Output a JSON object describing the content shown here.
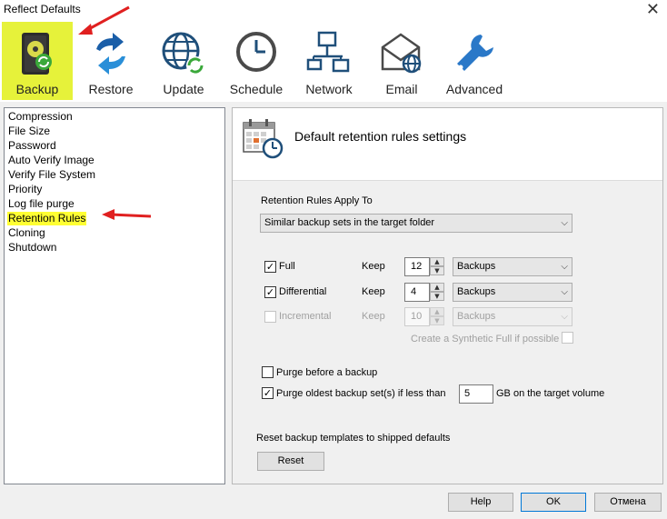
{
  "window": {
    "title": "Reflect Defaults"
  },
  "toolbar": {
    "items": [
      {
        "label": "Backup",
        "icon": "backup-drive-icon",
        "active": true
      },
      {
        "label": "Restore",
        "icon": "restore-arrows-icon"
      },
      {
        "label": "Update",
        "icon": "globe-update-icon"
      },
      {
        "label": "Schedule",
        "icon": "clock-icon"
      },
      {
        "label": "Network",
        "icon": "network-icon"
      },
      {
        "label": "Email",
        "icon": "envelope-icon"
      },
      {
        "label": "Advanced",
        "icon": "wrench-icon"
      }
    ]
  },
  "nav": {
    "items": [
      {
        "label": "Compression"
      },
      {
        "label": "File Size"
      },
      {
        "label": "Password"
      },
      {
        "label": "Auto Verify Image"
      },
      {
        "label": "Verify File System"
      },
      {
        "label": "Priority"
      },
      {
        "label": "Log file purge"
      },
      {
        "label": "Retention Rules",
        "selected": true
      },
      {
        "label": "Cloning"
      },
      {
        "label": "Shutdown"
      }
    ]
  },
  "panel": {
    "title": "Default retention rules settings",
    "apply_to_label": "Retention Rules Apply To",
    "apply_to_value": "Similar backup sets in the target folder",
    "keep_label": "Keep",
    "rules": [
      {
        "label": "Full",
        "checked": true,
        "value": "12",
        "unit": "Backups",
        "enabled": true
      },
      {
        "label": "Differential",
        "checked": true,
        "value": "4",
        "unit": "Backups",
        "enabled": true
      },
      {
        "label": "Incremental",
        "checked": false,
        "value": "10",
        "unit": "Backups",
        "enabled": false
      }
    ],
    "synthetic_label": "Create a Synthetic Full if possible",
    "purge_before_label": "Purge before a backup",
    "purge_before_checked": false,
    "purge_oldest_label": "Purge oldest backup set(s) if less than",
    "purge_oldest_checked": true,
    "purge_oldest_value": "5",
    "purge_oldest_unit": "GB on the target volume",
    "reset_label": "Reset backup templates to shipped defaults",
    "reset_button": "Reset"
  },
  "footer": {
    "help": "Help",
    "ok": "OK",
    "cancel": "Отмена"
  },
  "colors": {
    "highlight": "#ffff33",
    "active_tab": "#e6f23a",
    "annotation_arrow": "#e02020"
  }
}
